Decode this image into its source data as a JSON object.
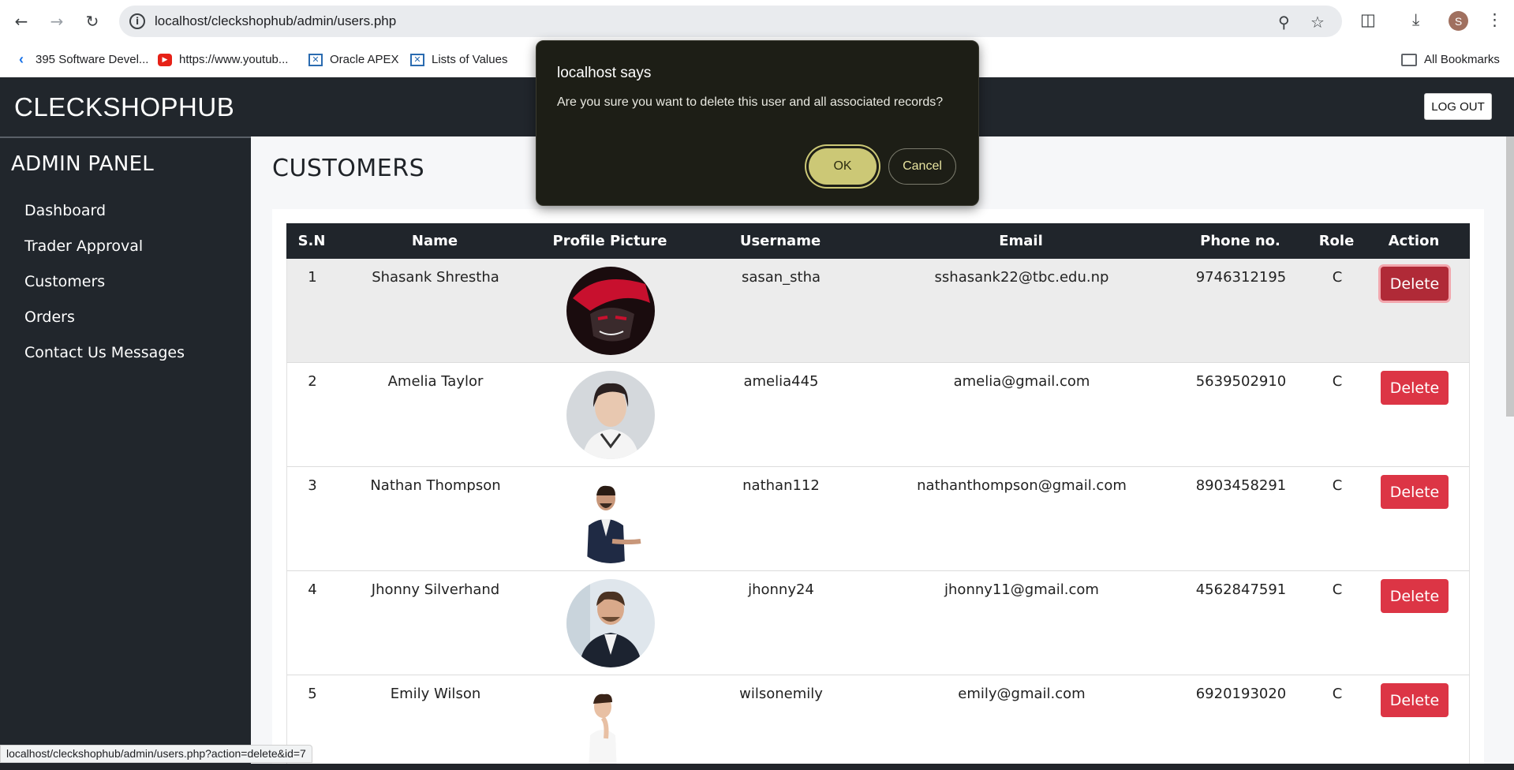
{
  "browser": {
    "url": "localhost/cleckshophub/admin/users.php",
    "back_icon": "arrow-left-icon",
    "forward_icon": "arrow-right-icon",
    "reload_icon": "reload-icon",
    "profile_initial": "S",
    "bookmarks": [
      {
        "label": "395 Software Devel...",
        "icon": "chevron-icon"
      },
      {
        "label": "https://www.youtub...",
        "icon": "youtube-icon"
      },
      {
        "label": "Oracle APEX",
        "icon": "apex-icon"
      },
      {
        "label": "Lists of Values",
        "icon": "apex-icon"
      }
    ],
    "all_bookmarks": "All Bookmarks",
    "status_url": "localhost/cleckshophub/admin/users.php?action=delete&id=7"
  },
  "header": {
    "brand": "CLECKSHOPHUB",
    "logout_label": "LOG OUT"
  },
  "sidebar": {
    "title": "ADMIN PANEL",
    "items": [
      {
        "label": "Dashboard"
      },
      {
        "label": "Trader Approval"
      },
      {
        "label": "Customers"
      },
      {
        "label": "Orders"
      },
      {
        "label": "Contact Us Messages"
      }
    ]
  },
  "main": {
    "title": "CUSTOMERS",
    "table": {
      "headers": [
        "S.N",
        "Name",
        "Profile Picture",
        "Username",
        "Email",
        "Phone no.",
        "Role",
        "Action"
      ],
      "rows": [
        {
          "sn": "1",
          "name": "Shasank Shrestha",
          "username": "sasan_stha",
          "email": "sshasank22@tbc.edu.np",
          "phone": "9746312195",
          "role": "C",
          "action": "Delete"
        },
        {
          "sn": "2",
          "name": "Amelia Taylor",
          "username": "amelia445",
          "email": "amelia@gmail.com",
          "phone": "5639502910",
          "role": "C",
          "action": "Delete"
        },
        {
          "sn": "3",
          "name": "Nathan Thompson",
          "username": "nathan112",
          "email": "nathanthompson@gmail.com",
          "phone": "8903458291",
          "role": "C",
          "action": "Delete"
        },
        {
          "sn": "4",
          "name": "Jhonny Silverhand",
          "username": "jhonny24",
          "email": "jhonny11@gmail.com",
          "phone": "4562847591",
          "role": "C",
          "action": "Delete"
        },
        {
          "sn": "5",
          "name": "Emily Wilson",
          "username": "wilsonemily",
          "email": "emily@gmail.com",
          "phone": "6920193020",
          "role": "C",
          "action": "Delete"
        }
      ]
    }
  },
  "dialog": {
    "title": "localhost says",
    "message": "Are you sure you want to delete this user and all associated records?",
    "ok_label": "OK",
    "cancel_label": "Cancel"
  },
  "colors": {
    "dark_bg": "#21262c",
    "delete_red": "#dc3545",
    "dialog_accent": "#ccc876"
  }
}
